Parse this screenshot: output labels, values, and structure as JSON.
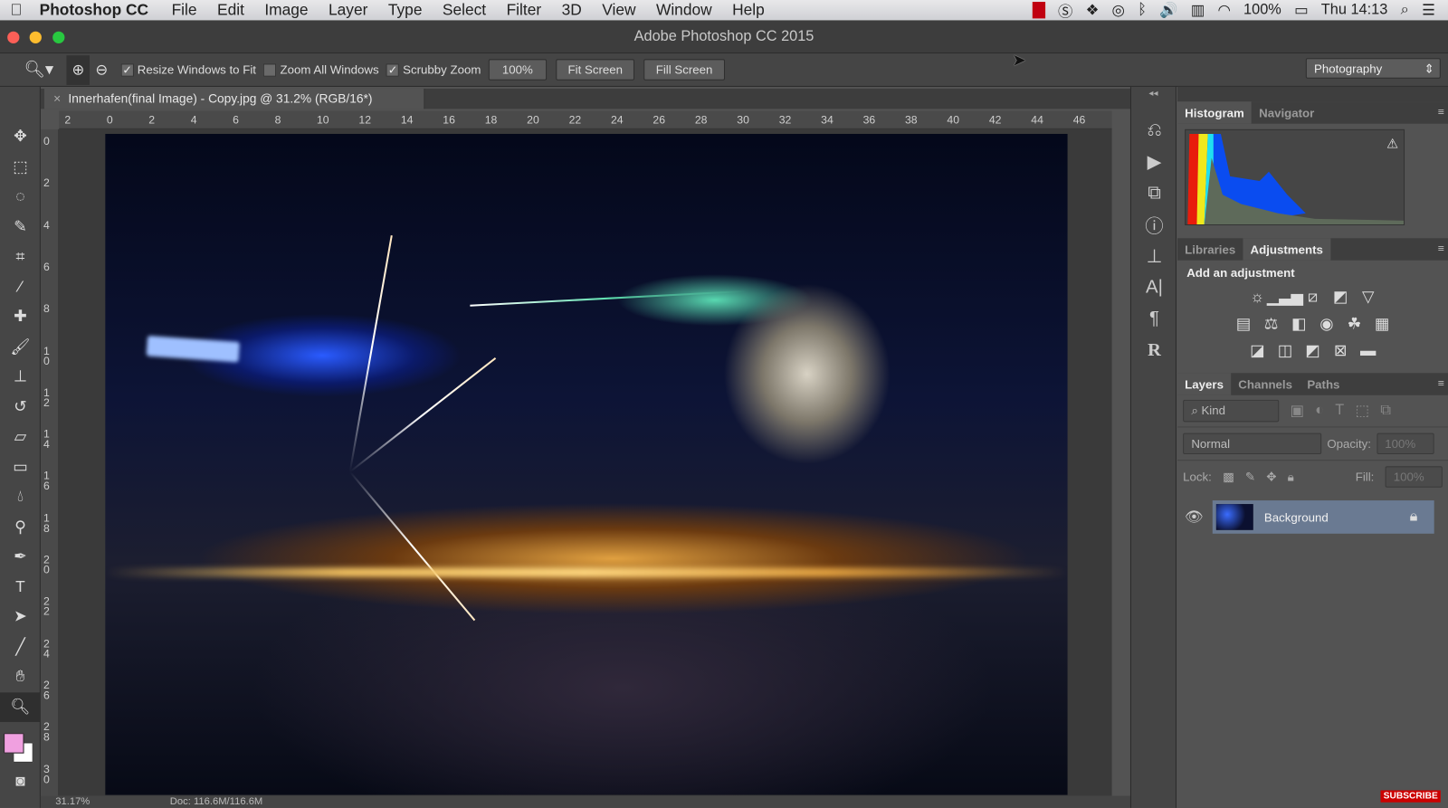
{
  "menubar": {
    "app": "Photoshop CC",
    "items": [
      "File",
      "Edit",
      "Image",
      "Layer",
      "Type",
      "Select",
      "Filter",
      "3D",
      "View",
      "Window",
      "Help"
    ],
    "status": {
      "battery": "100%",
      "clock": "Thu 14:13"
    }
  },
  "window": {
    "title": "Adobe Photoshop CC 2015"
  },
  "options": {
    "resize_windows": "Resize Windows to Fit",
    "resize_checked": true,
    "zoom_all": "Zoom All Windows",
    "zoom_all_checked": false,
    "scrubby": "Scrubby Zoom",
    "scrubby_checked": true,
    "btn_100": "100%",
    "fit_screen": "Fit Screen",
    "fill_screen": "Fill Screen",
    "workspace": "Photography"
  },
  "document": {
    "tab_title": "Innerhafen(final Image) - Copy.jpg @ 31.2% (RGB/16*)",
    "zoom": "31.17%",
    "doc_size": "Doc: 116.6M/116.6M"
  },
  "rulers": {
    "h": [
      "2",
      "0",
      "2",
      "4",
      "6",
      "8",
      "10",
      "12",
      "14",
      "16",
      "18",
      "20",
      "22",
      "24",
      "26",
      "28",
      "30",
      "32",
      "34",
      "36",
      "38",
      "40",
      "42",
      "44",
      "46"
    ],
    "v": [
      "0",
      "2",
      "4",
      "6",
      "8",
      "10",
      "12",
      "14",
      "16",
      "18",
      "20",
      "22",
      "24",
      "26",
      "28",
      "30"
    ]
  },
  "tools": [
    "move",
    "marquee",
    "lasso",
    "quick-select",
    "crop",
    "eyedropper",
    "healing",
    "brush",
    "stamp",
    "history-brush",
    "eraser",
    "gradient",
    "blur",
    "dodge",
    "pen",
    "type",
    "path-select",
    "line",
    "hand",
    "zoom"
  ],
  "colors": {
    "foreground": "#f0a0e0",
    "background": "#ffffff",
    "layer_selected": "#6a7a92"
  },
  "panels": {
    "histogram": {
      "tabs": [
        "Histogram",
        "Navigator"
      ]
    },
    "adjustments": {
      "tabs": [
        "Libraries",
        "Adjustments"
      ],
      "heading": "Add an adjustment"
    },
    "layers": {
      "tabs": [
        "Layers",
        "Channels",
        "Paths"
      ],
      "filter": "Kind",
      "blend_mode": "Normal",
      "opacity_label": "Opacity:",
      "opacity": "100%",
      "lock_label": "Lock:",
      "fill_label": "Fill:",
      "fill": "100%",
      "layers": [
        {
          "name": "Background",
          "visible": true,
          "locked": true
        }
      ]
    }
  },
  "overlay": {
    "subscribe": "SUBSCRIBE"
  }
}
